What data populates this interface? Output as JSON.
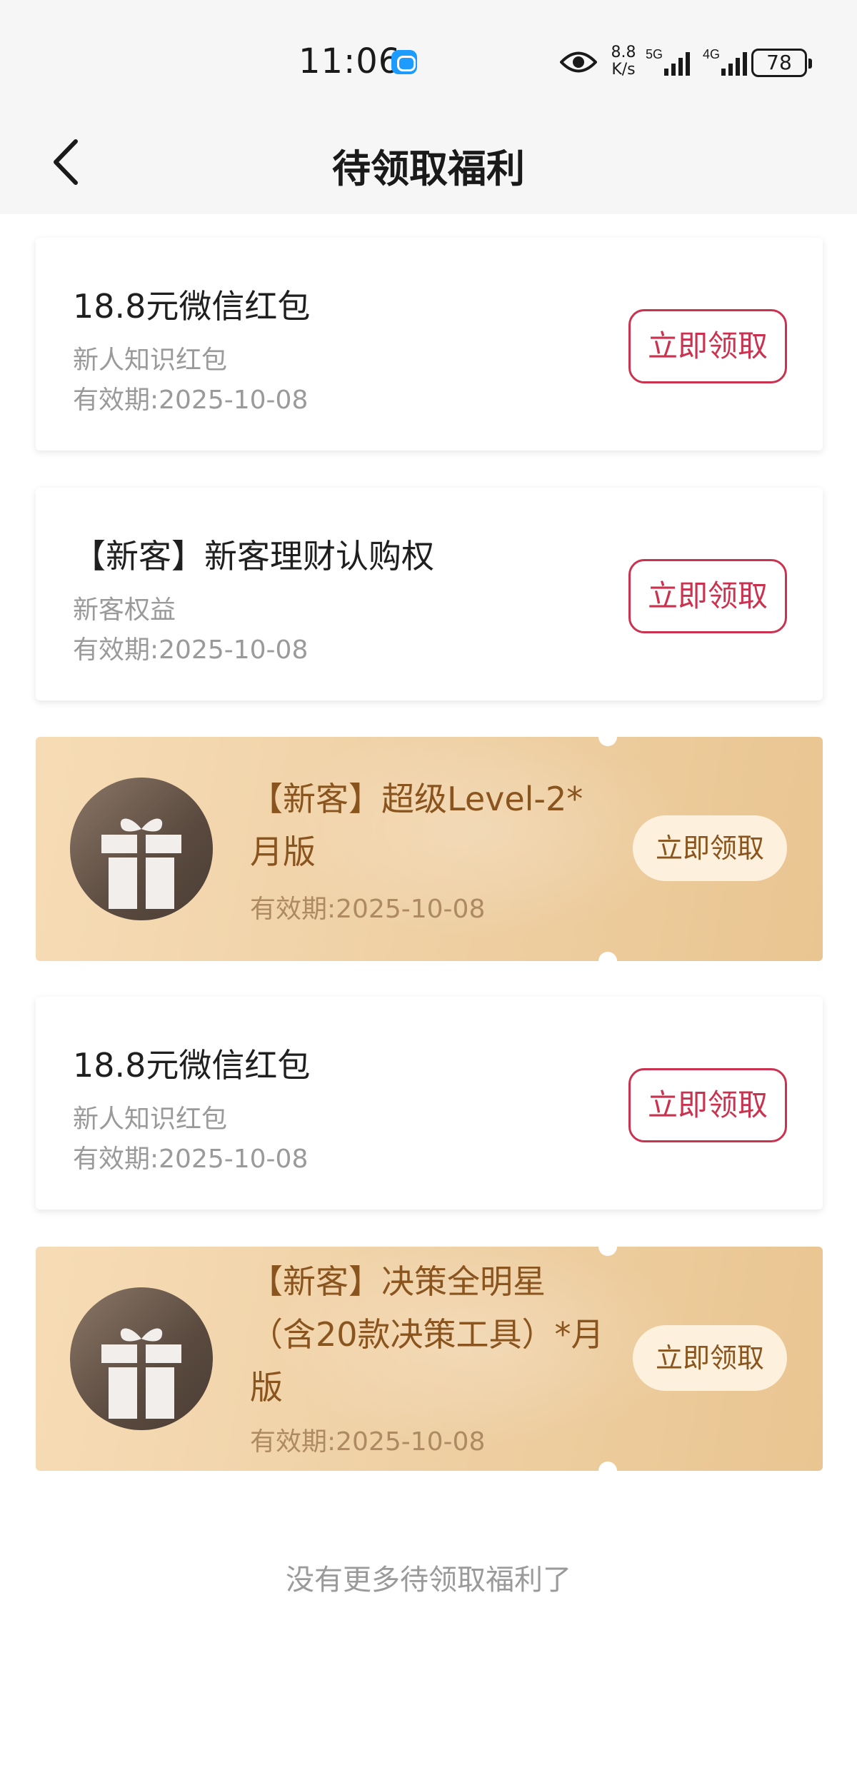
{
  "status_bar": {
    "time": "11:06",
    "net_speed_value": "8.8",
    "net_speed_unit": "K/s",
    "sig1_label": "5G",
    "sig2_label": "4G",
    "battery": "78"
  },
  "header": {
    "title": "待领取福利"
  },
  "benefits": [
    {
      "style": "plain",
      "title": "18.8元微信红包",
      "subtitle": "新人知识红包",
      "validity": "有效期:2025-10-08",
      "button": "立即领取"
    },
    {
      "style": "plain",
      "title": "【新客】新客理财认购权",
      "subtitle": "新客权益",
      "validity": "有效期:2025-10-08",
      "button": "立即领取"
    },
    {
      "style": "coupon",
      "icon": "gift-icon",
      "title_line1": "【新客】超级Level-2*",
      "title_line2": "月版",
      "validity": "有效期:2025-10-08",
      "button": "立即领取"
    },
    {
      "style": "plain",
      "title": "18.8元微信红包",
      "subtitle": "新人知识红包",
      "validity": "有效期:2025-10-08",
      "button": "立即领取"
    },
    {
      "style": "coupon",
      "icon": "gift-icon",
      "title_line1": "【新客】决策全明星",
      "title_line2": "（含20款决策工具）*月",
      "title_line3": "版",
      "validity": "有效期:2025-10-08",
      "button": "立即领取"
    }
  ],
  "footer": {
    "note": "没有更多待领取福利了"
  },
  "colors": {
    "accent_red": "#c9334f",
    "coupon_gold": "#efd0a4",
    "coupon_text": "#8a541e",
    "gift_brown": "#5a4a3f"
  }
}
